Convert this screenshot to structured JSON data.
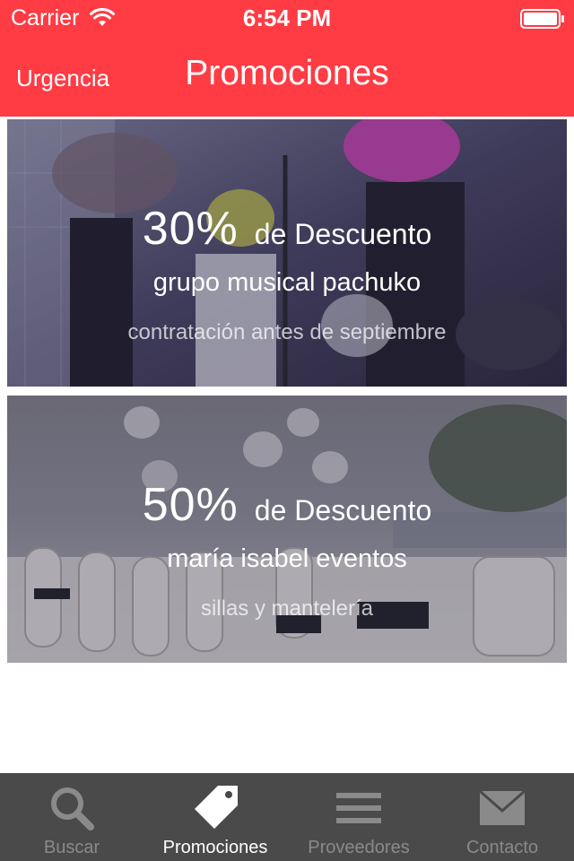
{
  "status_bar": {
    "carrier": "Carrier",
    "time": "6:54 PM",
    "wifi_icon": "wifi-icon",
    "battery_icon": "battery-icon"
  },
  "nav": {
    "back_label": "Urgencia",
    "title": "Promociones"
  },
  "promotions": [
    {
      "percent": "30%",
      "label": "de Descuento",
      "name": "grupo musical pachuko",
      "detail": "contratación antes de septiembre",
      "image": "band-performance-photo"
    },
    {
      "percent": "50%",
      "label": "de Descuento",
      "name": "maría isabel eventos",
      "detail": "sillas y mantelería",
      "image": "outdoor-event-tables-photo"
    }
  ],
  "tab_bar": {
    "tabs": [
      {
        "label": "Buscar",
        "icon": "search-icon",
        "active": false
      },
      {
        "label": "Promociones",
        "icon": "tag-icon",
        "active": true
      },
      {
        "label": "Proveedores",
        "icon": "list-icon",
        "active": false
      },
      {
        "label": "Contacto",
        "icon": "envelope-icon",
        "active": false
      }
    ]
  },
  "colors": {
    "header": "#ff3b44",
    "tab_bar": "#4a4a4a",
    "tab_inactive": "#8a8a8a",
    "tab_active": "#ffffff"
  }
}
